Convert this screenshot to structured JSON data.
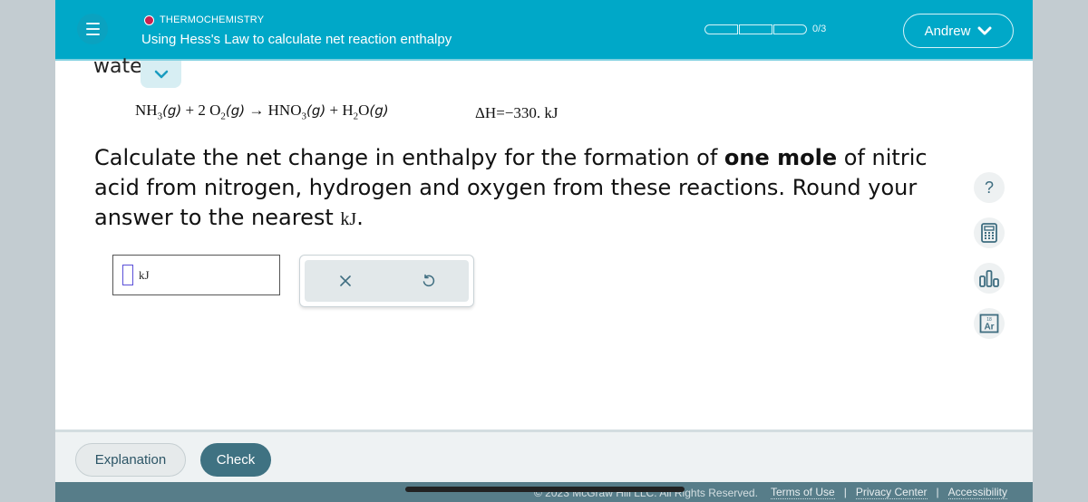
{
  "header": {
    "topic": "THERMOCHEMISTRY",
    "topic_dot_color": "#c8214f",
    "lesson_title": "Using Hess's Law to calculate net reaction enthalpy",
    "progress": {
      "completed": 0,
      "total": 3,
      "label": "0/3"
    },
    "user_name": "Andrew",
    "menu_icon": "hamburger-icon",
    "accent_color": "#00a8c8"
  },
  "content": {
    "cut_off_word": "wate",
    "equation": {
      "reactant1": "NH",
      "reactant1_sub": "3",
      "state": "(g)",
      "plus": "+",
      "coef2": "2",
      "reactant2": "O",
      "reactant2_sub": "2",
      "arrow": "→",
      "product1": "HNO",
      "product1_sub": "3",
      "product2_pre": "H",
      "product2_sub": "2",
      "product2_post": "O",
      "delta_h": "ΔH=−330. kJ"
    },
    "question": {
      "part1": "Calculate the net change in enthalpy for the formation of ",
      "bold": "one mole",
      "part2": " of nitric acid from nitrogen, hydrogen and oxygen from these reactions. Round your answer to the nearest ",
      "unit": "kJ",
      "end": "."
    },
    "answer": {
      "value": "",
      "unit": "kJ"
    },
    "tools": {
      "clear_icon": "close-icon",
      "undo_icon": "undo-icon"
    }
  },
  "side_tools": [
    {
      "name": "help",
      "glyph": "?"
    },
    {
      "name": "calculator"
    },
    {
      "name": "data-chart"
    },
    {
      "name": "periodic-table",
      "mass": "18",
      "symbol": "Ar"
    }
  ],
  "footer": {
    "explanation_label": "Explanation",
    "check_label": "Check",
    "copyright": "© 2023 McGraw Hill LLC. All Rights Reserved.",
    "links": [
      "Terms of Use",
      "Privacy Center",
      "Accessibility"
    ],
    "separator": "|"
  }
}
